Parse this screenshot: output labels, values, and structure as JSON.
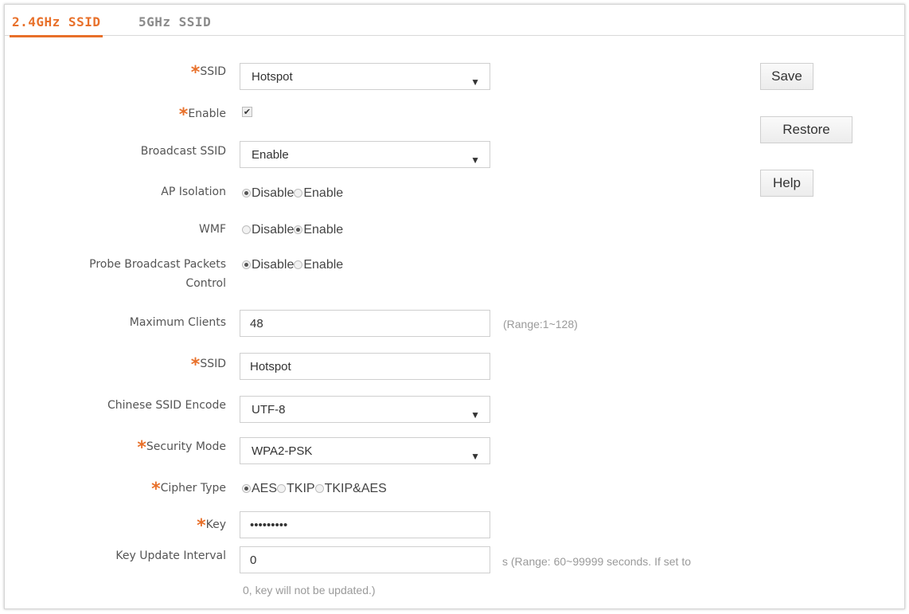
{
  "tabs": [
    "2.4GHz SSID",
    "5GHz SSID"
  ],
  "form": {
    "ssid_select": {
      "label": "SSID",
      "value": "Hotspot"
    },
    "enable": {
      "label": "Enable",
      "checked": true
    },
    "broadcast_ssid": {
      "label": "Broadcast SSID",
      "value": "Enable"
    },
    "ap_isolation": {
      "label": "AP Isolation",
      "options": [
        "Disable",
        "Enable"
      ],
      "selected": "Disable"
    },
    "wmf": {
      "label": "WMF",
      "options": [
        "Disable",
        "Enable"
      ],
      "selected": "Enable"
    },
    "probe_broadcast": {
      "label_line1": "Probe Broadcast Packets",
      "label_line2": "Control",
      "options": [
        "Disable",
        "Enable"
      ],
      "selected": "Disable"
    },
    "max_clients": {
      "label": "Maximum Clients",
      "value": "48",
      "hint": "(Range:1~128)"
    },
    "ssid_name": {
      "label": "SSID",
      "value": "Hotspot"
    },
    "chinese_encode": {
      "label": "Chinese SSID Encode",
      "value": "UTF-8"
    },
    "security_mode": {
      "label": "Security Mode",
      "value": "WPA2-PSK"
    },
    "cipher_type": {
      "label": "Cipher Type",
      "options": [
        "AES",
        "TKIP",
        "TKIP&AES"
      ],
      "selected": "AES"
    },
    "key": {
      "label": "Key",
      "value": "•••••••••"
    },
    "key_update": {
      "label": "Key Update Interval",
      "value": "0",
      "hint_line1": "s (Range: 60~99999 seconds. If set to",
      "hint_line2": "0, key will not be updated.)"
    }
  },
  "required_marker": "*",
  "dropdown_caret": "▼",
  "check_mark": "✔",
  "buttons": {
    "save": "Save",
    "restore": "Restore",
    "help": "Help"
  },
  "colors": {
    "accent": "#e8702a",
    "inactive_tab": "#8a8a8a"
  }
}
